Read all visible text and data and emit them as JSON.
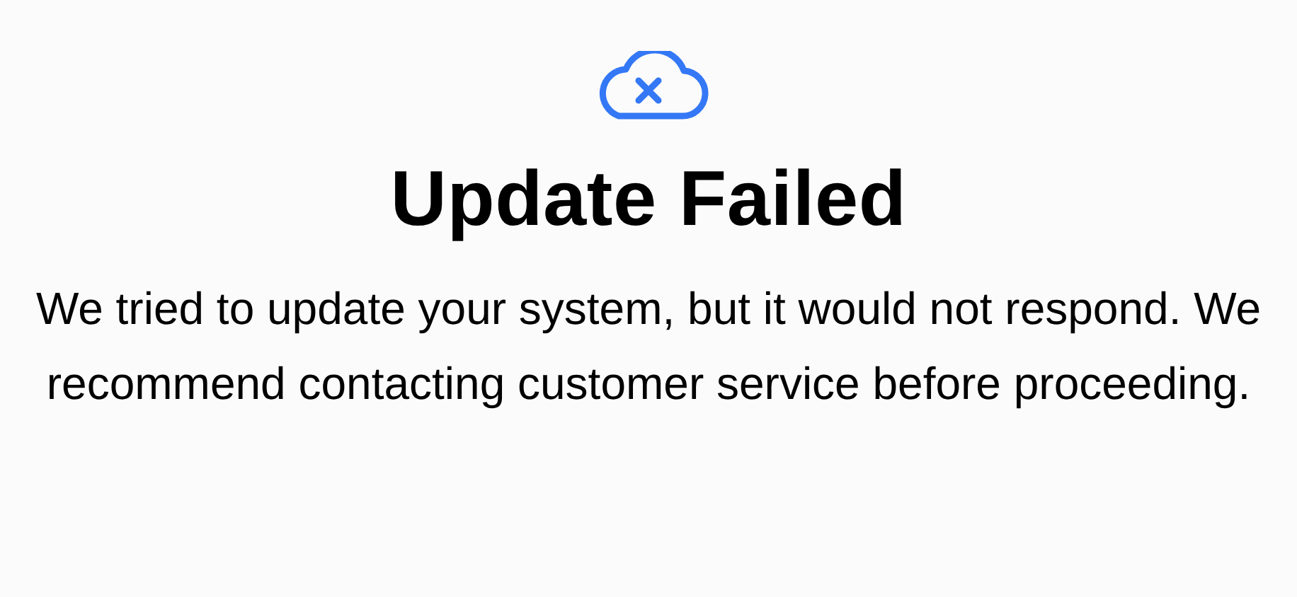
{
  "alert": {
    "title": "Update Failed",
    "message": "We tried to update your system, but it would not respond. We recommend contacting customer service before proceeding."
  }
}
